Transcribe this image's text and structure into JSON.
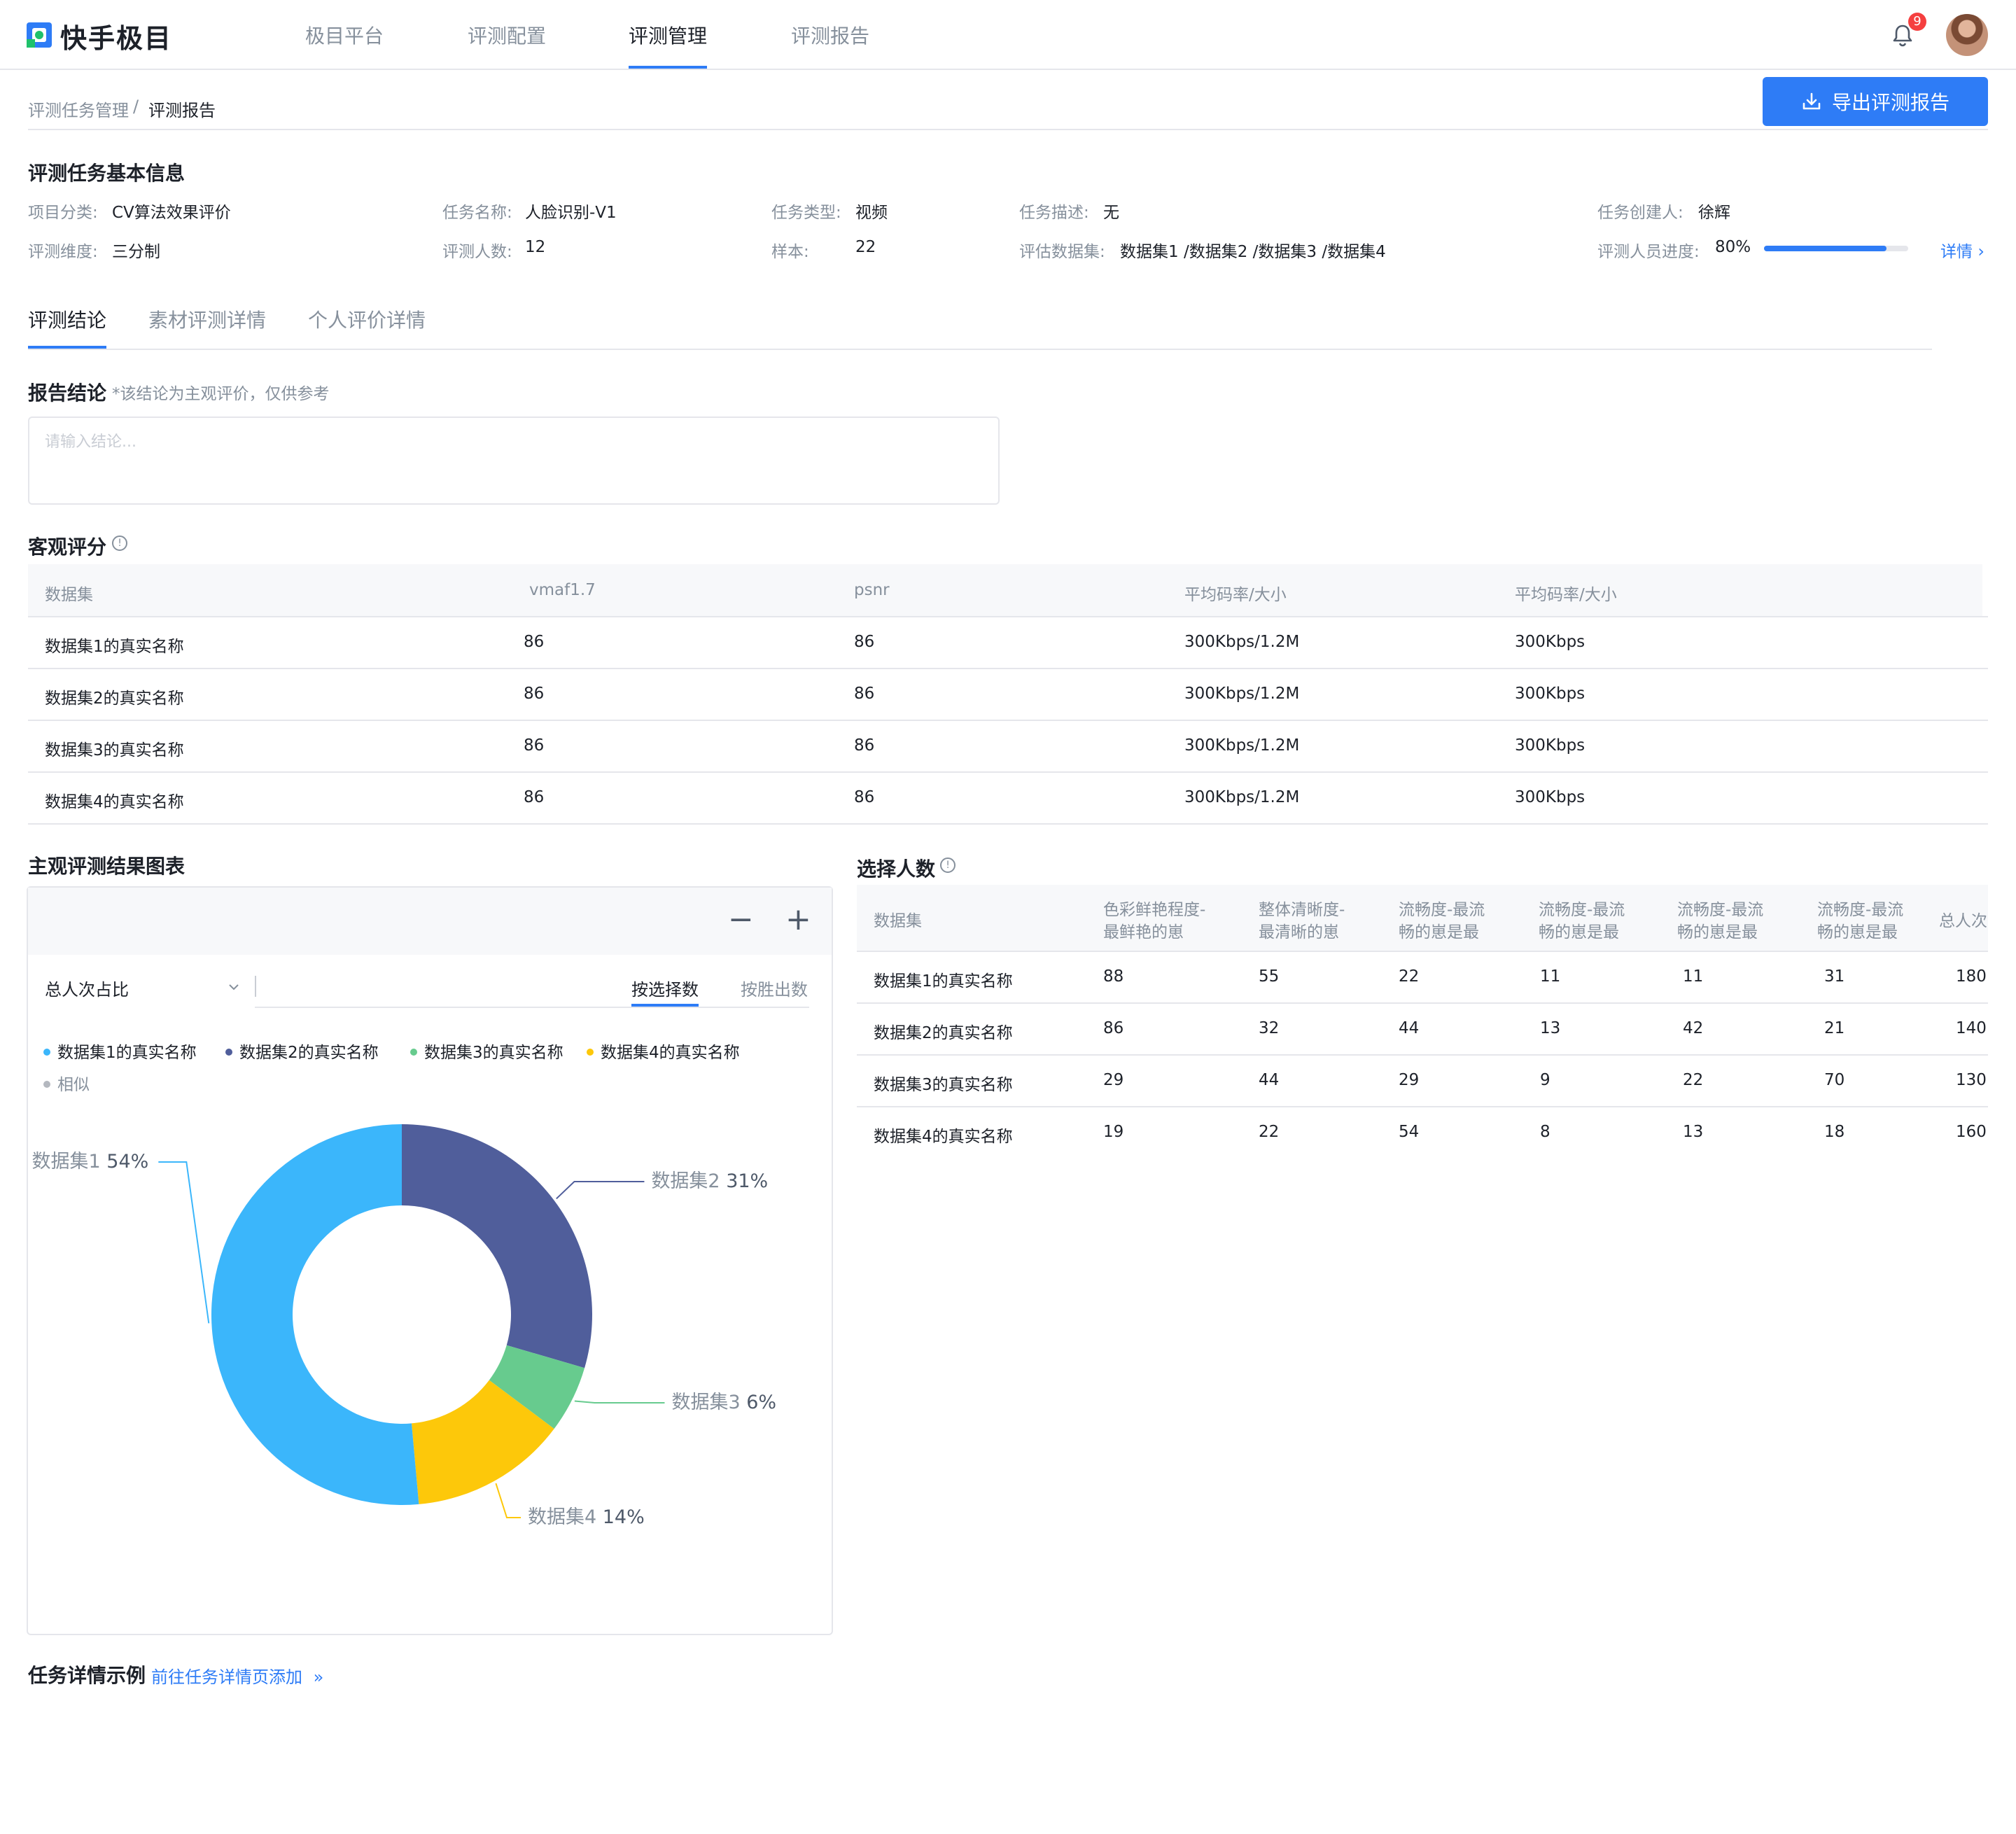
{
  "app": {
    "name": "快手极目",
    "logo_icon": "kuaishou-logo-icon"
  },
  "nav": {
    "items": [
      {
        "label": "极目平台",
        "active": false
      },
      {
        "label": "评测配置",
        "active": false
      },
      {
        "label": "评测管理",
        "active": true
      },
      {
        "label": "评测报告",
        "active": false
      }
    ],
    "notification_count": "9"
  },
  "breadcrumb": {
    "parent": "评测任务管理",
    "separator": "/",
    "current": "评测报告"
  },
  "export_label": "导出评测报告",
  "basic_info": {
    "title": "评测任务基本信息",
    "fields": {
      "category_label": "项目分类:",
      "category_value": "CV算法效果评价",
      "name_label": "任务名称:",
      "name_value": "人脸识别-V1",
      "type_label": "任务类型:",
      "type_value": "视频",
      "desc_label": "任务描述:",
      "desc_value": "无",
      "creator_label": "任务创建人:",
      "creator_value": "徐辉",
      "dimension_label": "评测维度:",
      "dimension_value": "三分制",
      "people_label": "评测人数:",
      "people_value": "12",
      "sample_label": "样本:",
      "sample_value": "22",
      "dataset_label": "评估数据集:",
      "dataset_value": "数据集1 /数据集2 /数据集3 /数据集4",
      "progress_label": "评测人员进度:",
      "progress_value": "80%",
      "progress_fraction": 0.85
    },
    "detail_link": "详情"
  },
  "tabs": [
    "评测结论",
    "素材评测详情",
    "个人评价详情"
  ],
  "conclusion": {
    "title": "报告结论",
    "note": "*该结论为主观评价，仅供参考",
    "placeholder": "请输入结论..."
  },
  "objective": {
    "title": "客观评分",
    "columns": [
      "数据集",
      "vmaf1.7",
      "psnr",
      "平均码率/大小",
      "平均码率/大小"
    ],
    "rows": [
      [
        "数据集1的真实名称",
        "86",
        "86",
        "300Kbps/1.2M",
        "300Kbps"
      ],
      [
        "数据集2的真实名称",
        "86",
        "86",
        "300Kbps/1.2M",
        "300Kbps"
      ],
      [
        "数据集3的真实名称",
        "86",
        "86",
        "300Kbps/1.2M",
        "300Kbps"
      ],
      [
        "数据集4的真实名称",
        "86",
        "86",
        "300Kbps/1.2M",
        "300Kbps"
      ]
    ]
  },
  "subjective_chart": {
    "title": "主观评测结果图表",
    "zoom_out": "−",
    "zoom_in": "+",
    "select_value": "总人次占比",
    "modes": [
      "按选择数",
      "按胜出数"
    ],
    "legend": [
      {
        "label": "数据集1的真实名称",
        "color": "#3bb6fb"
      },
      {
        "label": "数据集2的真实名称",
        "color": "#505e9b"
      },
      {
        "label": "数据集3的真实名称",
        "color": "#67cb8e"
      },
      {
        "label": "数据集4的真实名称",
        "color": "#fdc80a"
      },
      {
        "label": "相似",
        "color": "#b4b8bf"
      }
    ]
  },
  "chart_data": {
    "type": "pie",
    "categories": [
      "数据集1",
      "数据集2",
      "数据集3",
      "数据集4"
    ],
    "values": [
      54,
      31,
      6,
      14
    ],
    "labels": [
      "54%",
      "31%",
      "6%",
      "14%"
    ],
    "colors": [
      "#3bb6fb",
      "#505e9b",
      "#67cb8e",
      "#fdc80a"
    ],
    "donut": true
  },
  "selection": {
    "title": "选择人数",
    "columns": [
      [
        "数据集"
      ],
      [
        "色彩鲜艳程度-",
        "最鲜艳的崽"
      ],
      [
        "整体清晰度-",
        "最清晰的崽"
      ],
      [
        "流畅度-最流",
        "畅的崽是最"
      ],
      [
        "流畅度-最流",
        "畅的崽是最"
      ],
      [
        "流畅度-最流",
        "畅的崽是最"
      ],
      [
        "流畅度-最流",
        "畅的崽是最"
      ],
      [
        "总人次"
      ]
    ],
    "rows": [
      [
        "数据集1的真实名称",
        "88",
        "55",
        "22",
        "11",
        "11",
        "31",
        "180"
      ],
      [
        "数据集2的真实名称",
        "86",
        "32",
        "44",
        "13",
        "42",
        "21",
        "140"
      ],
      [
        "数据集3的真实名称",
        "29",
        "44",
        "29",
        "9",
        "22",
        "70",
        "130"
      ],
      [
        "数据集4的真实名称",
        "19",
        "22",
        "54",
        "8",
        "13",
        "18",
        "160"
      ]
    ]
  },
  "task_detail": {
    "title": "任务详情示例",
    "link": "前往任务详情页添加"
  }
}
